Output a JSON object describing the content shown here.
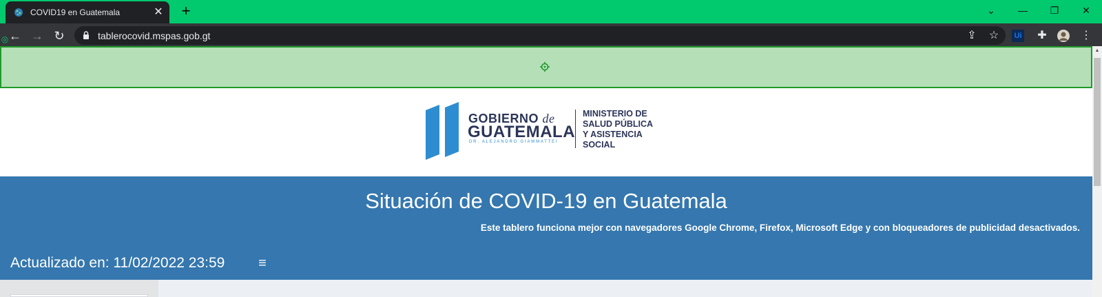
{
  "browser": {
    "tab": {
      "title": "COVID19 en Guatemala",
      "close_glyph": "✕"
    },
    "new_tab_glyph": "+",
    "window_controls": {
      "list_glyph": "⌄",
      "minimize_glyph": "—",
      "restore_glyph": "❐",
      "close_glyph": "✕"
    },
    "nav": {
      "back_glyph": "←",
      "forward_glyph": "→",
      "reload_glyph": "↻"
    },
    "address_bar": {
      "url": "tablerocovid.mspas.gob.gt"
    },
    "toolbar_icons": {
      "share_glyph": "⇪",
      "star_glyph": "☆",
      "ext1_glyph": "Ui",
      "puzzle_glyph": "✚",
      "menu_glyph": "⋮"
    },
    "accent_color": "#00c96e"
  },
  "page": {
    "logo": {
      "gobierno": "GOBIERNO",
      "de": "de",
      "guatemala": "GUATEMALA",
      "dr": "DR. ALEJANDRO GIAMMATTEI",
      "ministerio": "MINISTERIO DE\nSALUD PÚBLICA\nY ASISTENCIA\nSOCIAL"
    },
    "banner": {
      "title": "Situación de COVID-19 en Guatemala",
      "note": "Este tablero funciona mejor con navegadores Google Chrome, Firefox, Microsoft Edge y con bloqueadores de publicidad desactivados.",
      "updated": "Actualizado en: 11/02/2022 23:59",
      "menu_glyph": "≡",
      "color": "#3577ae"
    }
  }
}
